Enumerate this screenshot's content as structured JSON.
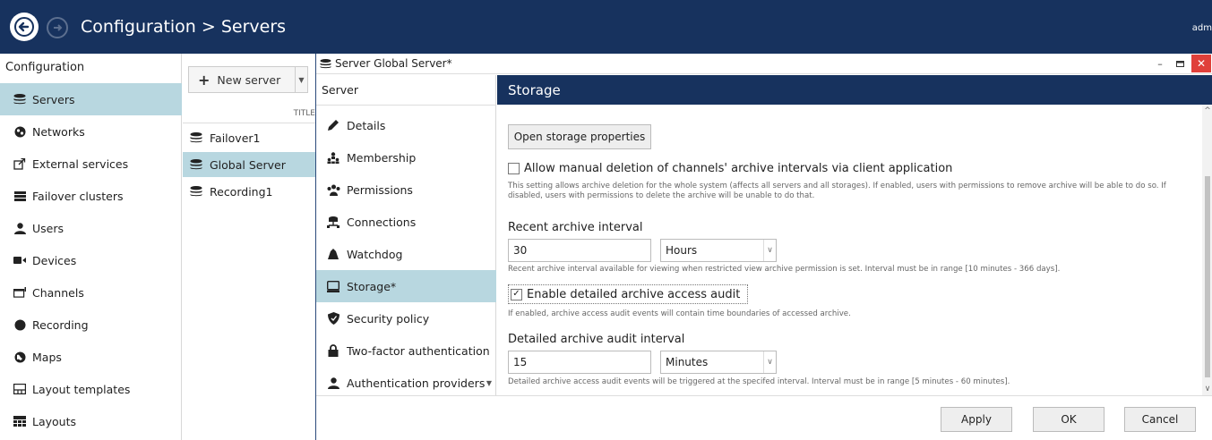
{
  "header": {
    "title": "Configuration > Servers",
    "user": "adm"
  },
  "sidebar": {
    "heading": "Configuration",
    "items": [
      {
        "label": "Servers",
        "icon": "servers-icon"
      },
      {
        "label": "Networks",
        "icon": "network-icon"
      },
      {
        "label": "External services",
        "icon": "external-link-icon"
      },
      {
        "label": "Failover clusters",
        "icon": "failover-icon"
      },
      {
        "label": "Users",
        "icon": "user-icon"
      },
      {
        "label": "Devices",
        "icon": "camera-icon"
      },
      {
        "label": "Channels",
        "icon": "channel-icon"
      },
      {
        "label": "Recording",
        "icon": "record-icon"
      },
      {
        "label": "Maps",
        "icon": "globe-icon"
      },
      {
        "label": "Layout templates",
        "icon": "layout-template-icon"
      },
      {
        "label": "Layouts",
        "icon": "layouts-icon"
      }
    ],
    "active_index": 0
  },
  "serverlist": {
    "new_server_label": "New server",
    "column_title": "TITLE",
    "servers": [
      "Failover1",
      "Global Server",
      "Recording1"
    ],
    "active_index": 1
  },
  "dialog": {
    "title": "Server Global Server*",
    "nav_heading": "Server",
    "nav_items": [
      {
        "label": "Details",
        "icon": "pencil-icon"
      },
      {
        "label": "Membership",
        "icon": "membership-icon"
      },
      {
        "label": "Permissions",
        "icon": "permissions-icon"
      },
      {
        "label": "Connections",
        "icon": "connections-icon"
      },
      {
        "label": "Watchdog",
        "icon": "watchdog-icon"
      },
      {
        "label": "Storage*",
        "icon": "storage-icon"
      },
      {
        "label": "Security policy",
        "icon": "shield-icon"
      },
      {
        "label": "Two-factor authentication",
        "icon": "lock-icon"
      },
      {
        "label": "Authentication providers",
        "icon": "user-icon"
      }
    ],
    "active_nav_index": 5,
    "content": {
      "heading": "Storage",
      "open_storage_button": "Open storage properties",
      "allow_deletion": {
        "label": "Allow manual deletion of channels' archive intervals via client application",
        "checked": false,
        "hint": "This setting allows archive deletion for the whole system (affects all servers and all storages). If enabled, users with permissions to remove archive will be able to do so. If disabled, users with permissions to delete the archive will be unable to do that."
      },
      "recent_interval": {
        "label": "Recent archive interval",
        "value": "30",
        "unit": "Hours",
        "hint": "Recent archive interval available for viewing when restricted view archive permission is set. Interval must be in range [10 minutes - 366 days]."
      },
      "audit": {
        "label": "Enable detailed archive access audit",
        "checked": true,
        "hint": "If enabled, archive access audit events will contain time boundaries of accessed archive."
      },
      "audit_interval": {
        "label": "Detailed archive audit interval",
        "value": "15",
        "unit": "Minutes",
        "hint": "Detailed archive access audit events will be triggered at the specifed interval. Interval must be in range [5 minutes - 60 minutes]."
      }
    },
    "buttons": {
      "apply": "Apply",
      "ok": "OK",
      "cancel": "Cancel"
    }
  },
  "colors": {
    "header_bg": "#17325e",
    "selected_bg": "#b8d7e0",
    "close_red": "#e0403a"
  }
}
